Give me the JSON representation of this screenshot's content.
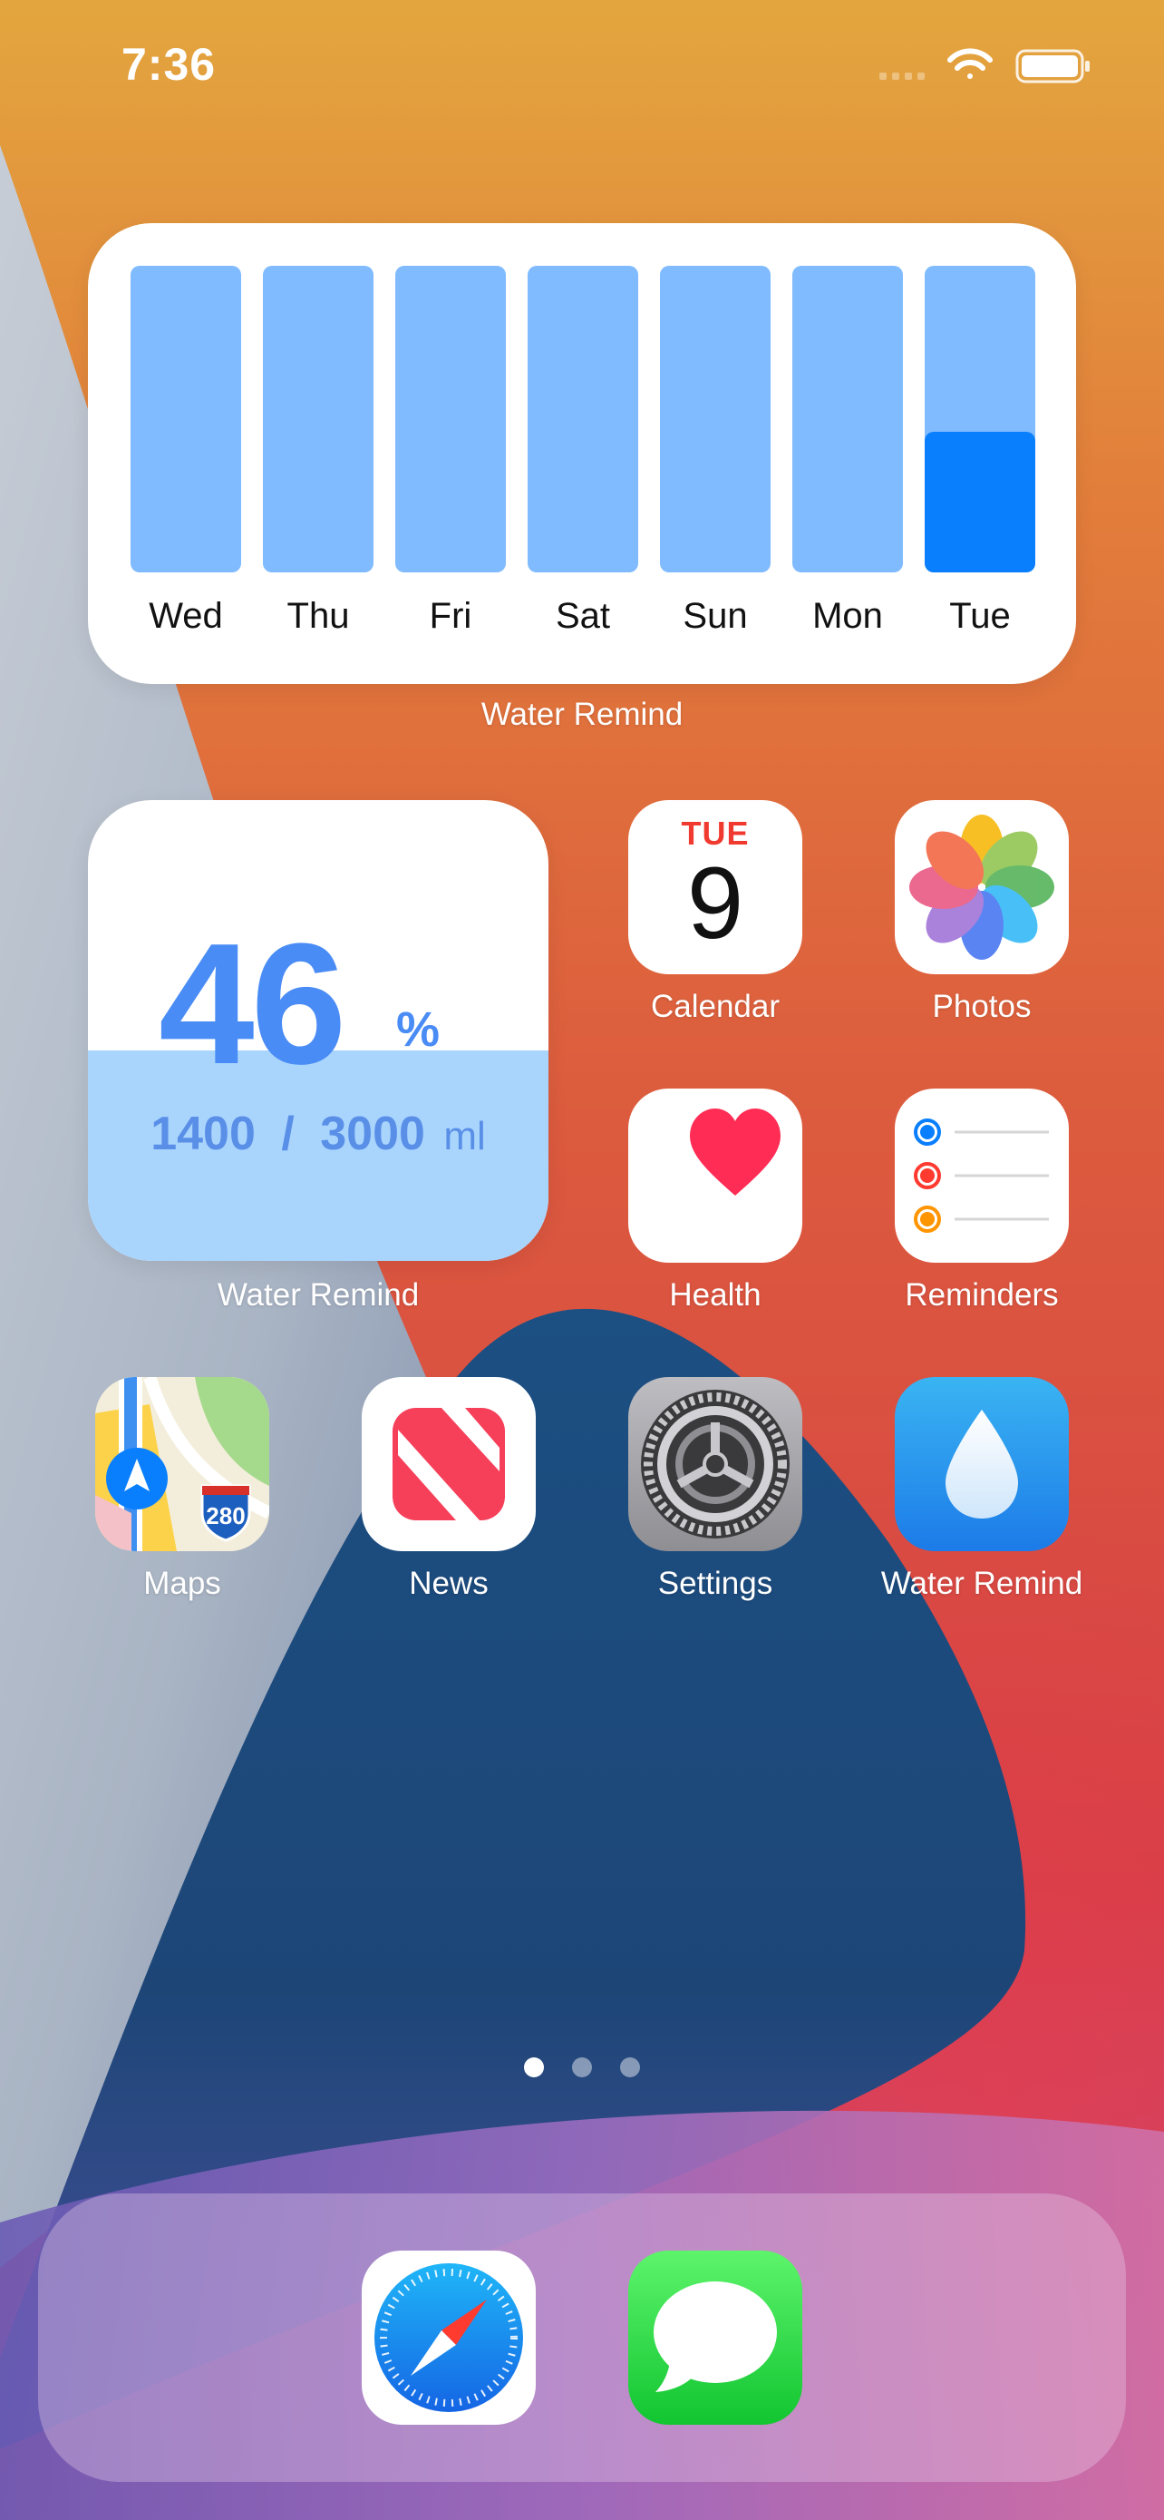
{
  "status_bar": {
    "time": "7:36",
    "icons": [
      "signal-icon",
      "wifi-icon",
      "battery-icon"
    ]
  },
  "weekly_widget": {
    "label": "Water Remind",
    "days": [
      {
        "name": "Wed",
        "fill": 0
      },
      {
        "name": "Thu",
        "fill": 0
      },
      {
        "name": "Fri",
        "fill": 0
      },
      {
        "name": "Sat",
        "fill": 0
      },
      {
        "name": "Sun",
        "fill": 0
      },
      {
        "name": "Mon",
        "fill": 0
      },
      {
        "name": "Tue",
        "fill": 0.46
      }
    ],
    "colors": {
      "track": "#80bbff",
      "fill": "#0a7ffd"
    }
  },
  "progress_widget": {
    "label": "Water Remind",
    "percent": "46",
    "percent_symbol": "%",
    "current": "1400",
    "separator": "/",
    "goal": "3000",
    "unit": "ml",
    "fill_fraction": 0.46,
    "colors": {
      "text": "#4a8cf5",
      "water": "#a9d5fd"
    }
  },
  "calendar": {
    "weekday": "TUE",
    "date": "9"
  },
  "apps": {
    "calendar": "Calendar",
    "photos": "Photos",
    "health": "Health",
    "reminders": "Reminders",
    "maps": "Maps",
    "news": "News",
    "settings": "Settings",
    "water_remind": "Water Remind"
  },
  "maps_shield": "280",
  "page_indicator": {
    "count": 3,
    "active": 1
  },
  "dock": {
    "apps": [
      "safari-icon",
      "messages-icon"
    ]
  }
}
